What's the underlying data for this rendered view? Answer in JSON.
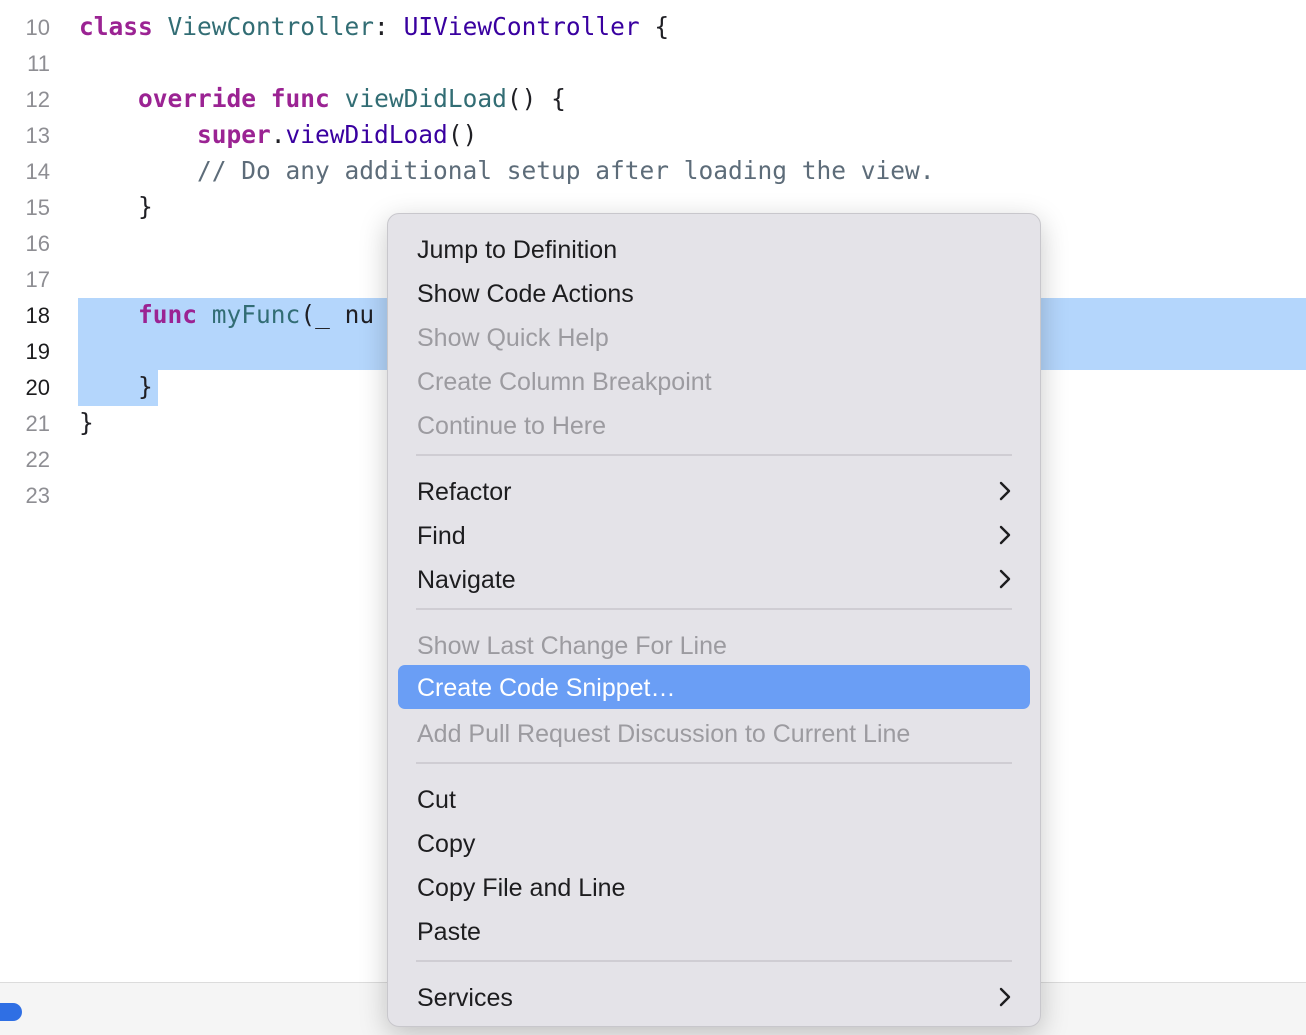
{
  "editor": {
    "lines": [
      {
        "num": "10",
        "tokens": [
          {
            "t": "class",
            "c": "kw"
          },
          {
            "t": " ",
            "c": "pl"
          },
          {
            "t": "ViewController",
            "c": "fn"
          },
          {
            "t": ": ",
            "c": "pl"
          },
          {
            "t": "UIViewController",
            "c": "ty"
          },
          {
            "t": " {",
            "c": "pl"
          }
        ]
      },
      {
        "num": "11",
        "tokens": []
      },
      {
        "num": "12",
        "tokens": [
          {
            "t": "    ",
            "c": "pl"
          },
          {
            "t": "override",
            "c": "kw"
          },
          {
            "t": " ",
            "c": "pl"
          },
          {
            "t": "func",
            "c": "kw"
          },
          {
            "t": " ",
            "c": "pl"
          },
          {
            "t": "viewDidLoad",
            "c": "fn"
          },
          {
            "t": "() {",
            "c": "pl"
          }
        ]
      },
      {
        "num": "13",
        "tokens": [
          {
            "t": "        ",
            "c": "pl"
          },
          {
            "t": "super",
            "c": "kw"
          },
          {
            "t": ".",
            "c": "pl"
          },
          {
            "t": "viewDidLoad",
            "c": "ty"
          },
          {
            "t": "()",
            "c": "pl"
          }
        ]
      },
      {
        "num": "14",
        "tokens": [
          {
            "t": "        ",
            "c": "pl"
          },
          {
            "t": "// Do any additional setup after loading the view.",
            "c": "cm"
          }
        ]
      },
      {
        "num": "15",
        "tokens": [
          {
            "t": "    }",
            "c": "pl"
          }
        ]
      },
      {
        "num": "16",
        "tokens": []
      },
      {
        "num": "17",
        "tokens": []
      },
      {
        "num": "18",
        "tokens": [
          {
            "t": "    ",
            "c": "pl"
          },
          {
            "t": "func",
            "c": "kw"
          },
          {
            "t": " ",
            "c": "pl"
          },
          {
            "t": "myFunc",
            "c": "fn"
          },
          {
            "t": "(_ nu",
            "c": "pl"
          }
        ],
        "active": true
      },
      {
        "num": "19",
        "tokens": [],
        "active": true
      },
      {
        "num": "20",
        "tokens": [
          {
            "t": "    }",
            "c": "pl"
          }
        ],
        "active": true
      },
      {
        "num": "21",
        "tokens": [
          {
            "t": "}",
            "c": "pl"
          }
        ]
      },
      {
        "num": "22",
        "tokens": []
      },
      {
        "num": "23",
        "tokens": []
      }
    ]
  },
  "context_menu": {
    "items": [
      {
        "label": "Jump to Definition",
        "enabled": true
      },
      {
        "label": "Show Code Actions",
        "enabled": true
      },
      {
        "label": "Show Quick Help",
        "enabled": false
      },
      {
        "label": "Create Column Breakpoint",
        "enabled": false
      },
      {
        "label": "Continue to Here",
        "enabled": false
      },
      {
        "label": "Refactor",
        "enabled": true,
        "submenu": true
      },
      {
        "label": "Find",
        "enabled": true,
        "submenu": true
      },
      {
        "label": "Navigate",
        "enabled": true,
        "submenu": true
      },
      {
        "label": "Show Last Change For Line",
        "enabled": false
      },
      {
        "label": "Create Code Snippet…",
        "enabled": true,
        "highlighted": true
      },
      {
        "label": "Add Pull Request Discussion to Current Line",
        "enabled": false
      },
      {
        "label": "Cut",
        "enabled": true
      },
      {
        "label": "Copy",
        "enabled": true
      },
      {
        "label": "Copy File and Line",
        "enabled": true
      },
      {
        "label": "Paste",
        "enabled": true
      },
      {
        "label": "Services",
        "enabled": true,
        "submenu": true
      }
    ],
    "submenu_icon": "chevron-right-icon"
  },
  "colors": {
    "selection": "#b4d6fc",
    "menu_highlight": "#6a9ef5",
    "keyword": "#9b2393",
    "function": "#326d74",
    "type": "#3900a0",
    "comment": "#5d6c79"
  }
}
